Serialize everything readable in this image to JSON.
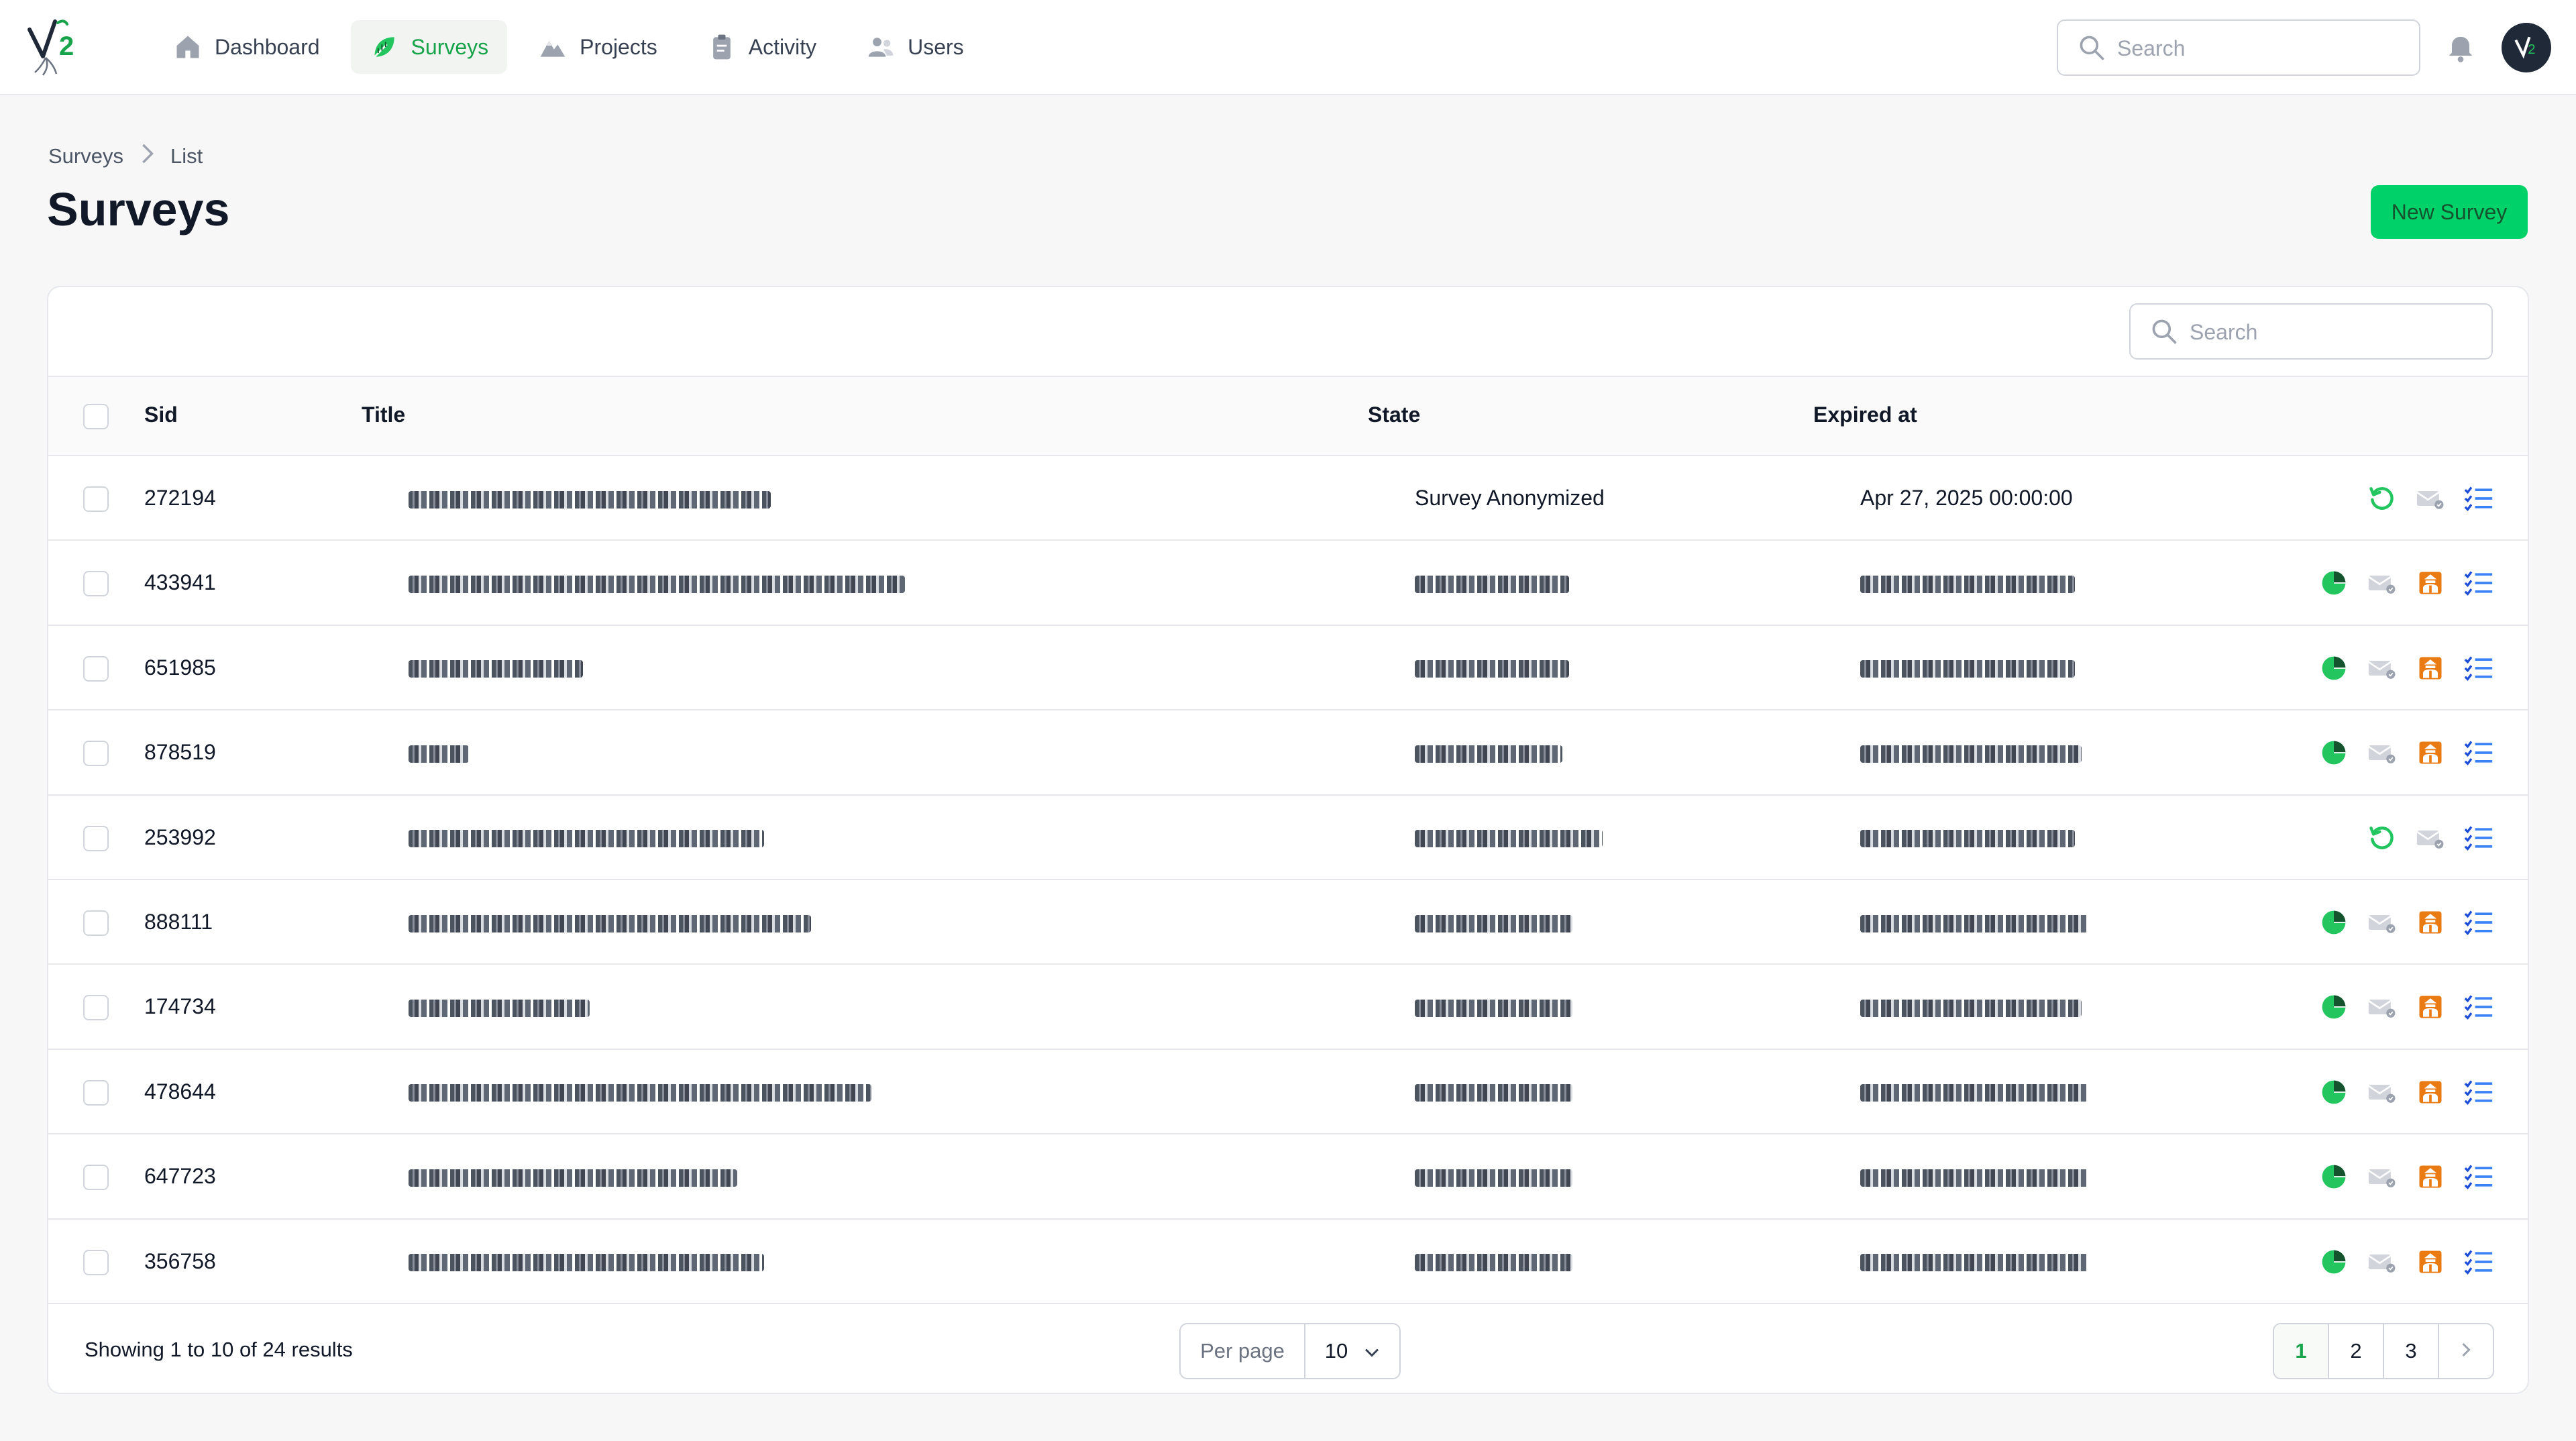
{
  "nav": {
    "items": [
      {
        "label": "Dashboard",
        "icon": "house-icon"
      },
      {
        "label": "Surveys",
        "icon": "leaf-icon"
      },
      {
        "label": "Projects",
        "icon": "mountains-icon"
      },
      {
        "label": "Activity",
        "icon": "clipboard-icon"
      },
      {
        "label": "Users",
        "icon": "users-icon"
      }
    ],
    "active": "Surveys",
    "search_placeholder": "Search"
  },
  "breadcrumb": [
    "Surveys",
    "List"
  ],
  "page": {
    "title": "Surveys",
    "new_button": "New Survey"
  },
  "table": {
    "search_placeholder": "Search",
    "columns": [
      "Sid",
      "Title",
      "State",
      "Expired at"
    ],
    "rows": [
      {
        "sid": "272194",
        "state": "Survey Anonymized",
        "expired_at": "Apr 27, 2025 00:00:00",
        "actions": [
          "restore-icon",
          "mail-icon",
          "checklist-icon"
        ]
      },
      {
        "sid": "433941",
        "state": "",
        "expired_at": "",
        "actions": [
          "pie-chart-icon",
          "mail-icon",
          "spy-icon",
          "checklist-icon"
        ]
      },
      {
        "sid": "651985",
        "state": "",
        "expired_at": "",
        "actions": [
          "pie-chart-icon",
          "mail-icon",
          "spy-icon",
          "checklist-icon"
        ]
      },
      {
        "sid": "878519",
        "state": "",
        "expired_at": "",
        "actions": [
          "pie-chart-icon",
          "mail-icon",
          "spy-icon",
          "checklist-icon"
        ]
      },
      {
        "sid": "253992",
        "state": "",
        "expired_at": "",
        "actions": [
          "restore-icon",
          "mail-icon",
          "checklist-icon"
        ]
      },
      {
        "sid": "888111",
        "state": "",
        "expired_at": "",
        "actions": [
          "pie-chart-icon",
          "mail-icon",
          "spy-icon",
          "checklist-icon"
        ]
      },
      {
        "sid": "174734",
        "state": "",
        "expired_at": "",
        "actions": [
          "pie-chart-icon",
          "mail-icon",
          "spy-icon",
          "checklist-icon"
        ]
      },
      {
        "sid": "478644",
        "state": "",
        "expired_at": "",
        "actions": [
          "pie-chart-icon",
          "mail-icon",
          "spy-icon",
          "checklist-icon"
        ]
      },
      {
        "sid": "647723",
        "state": "",
        "expired_at": "",
        "actions": [
          "pie-chart-icon",
          "mail-icon",
          "spy-icon",
          "checklist-icon"
        ]
      },
      {
        "sid": "356758",
        "state": "",
        "expired_at": "",
        "actions": [
          "pie-chart-icon",
          "mail-icon",
          "spy-icon",
          "checklist-icon"
        ]
      }
    ]
  },
  "footer": {
    "results": "Showing 1 to 10 of 24 results",
    "per_page_label": "Per page",
    "per_page_value": "10",
    "pages": [
      "1",
      "2",
      "3"
    ],
    "current_page": "1"
  },
  "colors": {
    "accent": "#16a34a",
    "button": "#00d26a",
    "orange": "#ea7a12",
    "blue": "#2563eb"
  }
}
